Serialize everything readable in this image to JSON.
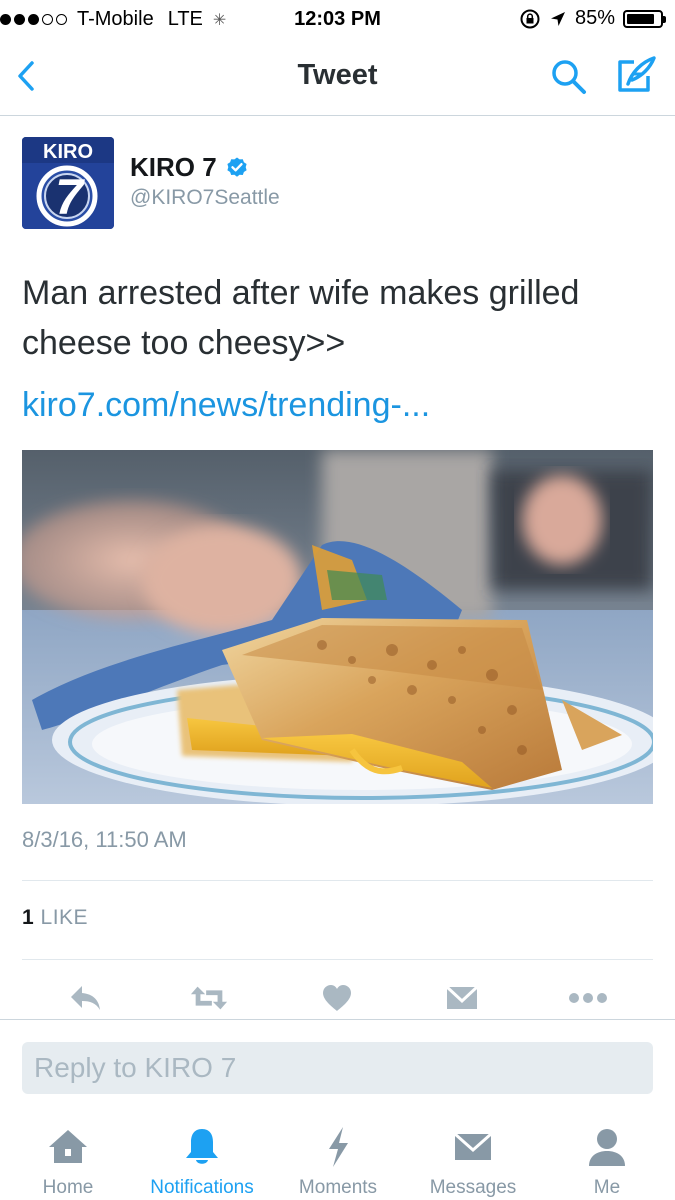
{
  "status_bar": {
    "carrier": "T-Mobile",
    "network": "LTE",
    "time": "12:03 PM",
    "battery": "85%",
    "battery_level": 0.85,
    "signal_bars": 3,
    "signal_total": 5
  },
  "nav": {
    "title": "Tweet"
  },
  "tweet": {
    "avatar": {
      "brand_text": "KIRO",
      "number": "7"
    },
    "display_name": "KIRO 7",
    "screen_name": "@KIRO7Seattle",
    "verified": true,
    "text": "Man arrested after wife makes grilled cheese too cheesy>>",
    "link_text": "kiro7.com/news/trending-...",
    "timestamp": "8/3/16, 11:50 AM",
    "likes": {
      "count": "1",
      "label": "LIKE"
    }
  },
  "actions": [
    {
      "name": "reply",
      "icon": "reply-icon"
    },
    {
      "name": "retweet",
      "icon": "retweet-icon"
    },
    {
      "name": "like",
      "icon": "heart-icon"
    },
    {
      "name": "direct-message",
      "icon": "envelope-icon"
    },
    {
      "name": "more",
      "icon": "more-icon"
    }
  ],
  "reply": {
    "placeholder": "Reply to KIRO 7"
  },
  "tabs": [
    {
      "label": "Home",
      "icon": "home-icon",
      "active": false
    },
    {
      "label": "Notifications",
      "icon": "bell-icon",
      "active": true
    },
    {
      "label": "Moments",
      "icon": "lightning-icon",
      "active": false
    },
    {
      "label": "Messages",
      "icon": "envelope-icon",
      "active": false
    },
    {
      "label": "Me",
      "icon": "person-icon",
      "active": false
    }
  ],
  "colors": {
    "accent": "#1da1f2",
    "link": "#1b95e0",
    "verified": "#1da1f2",
    "icon_gray": "#aab8c2",
    "secondary_text": "#8899a6",
    "avatar_blue": "#23439a"
  }
}
